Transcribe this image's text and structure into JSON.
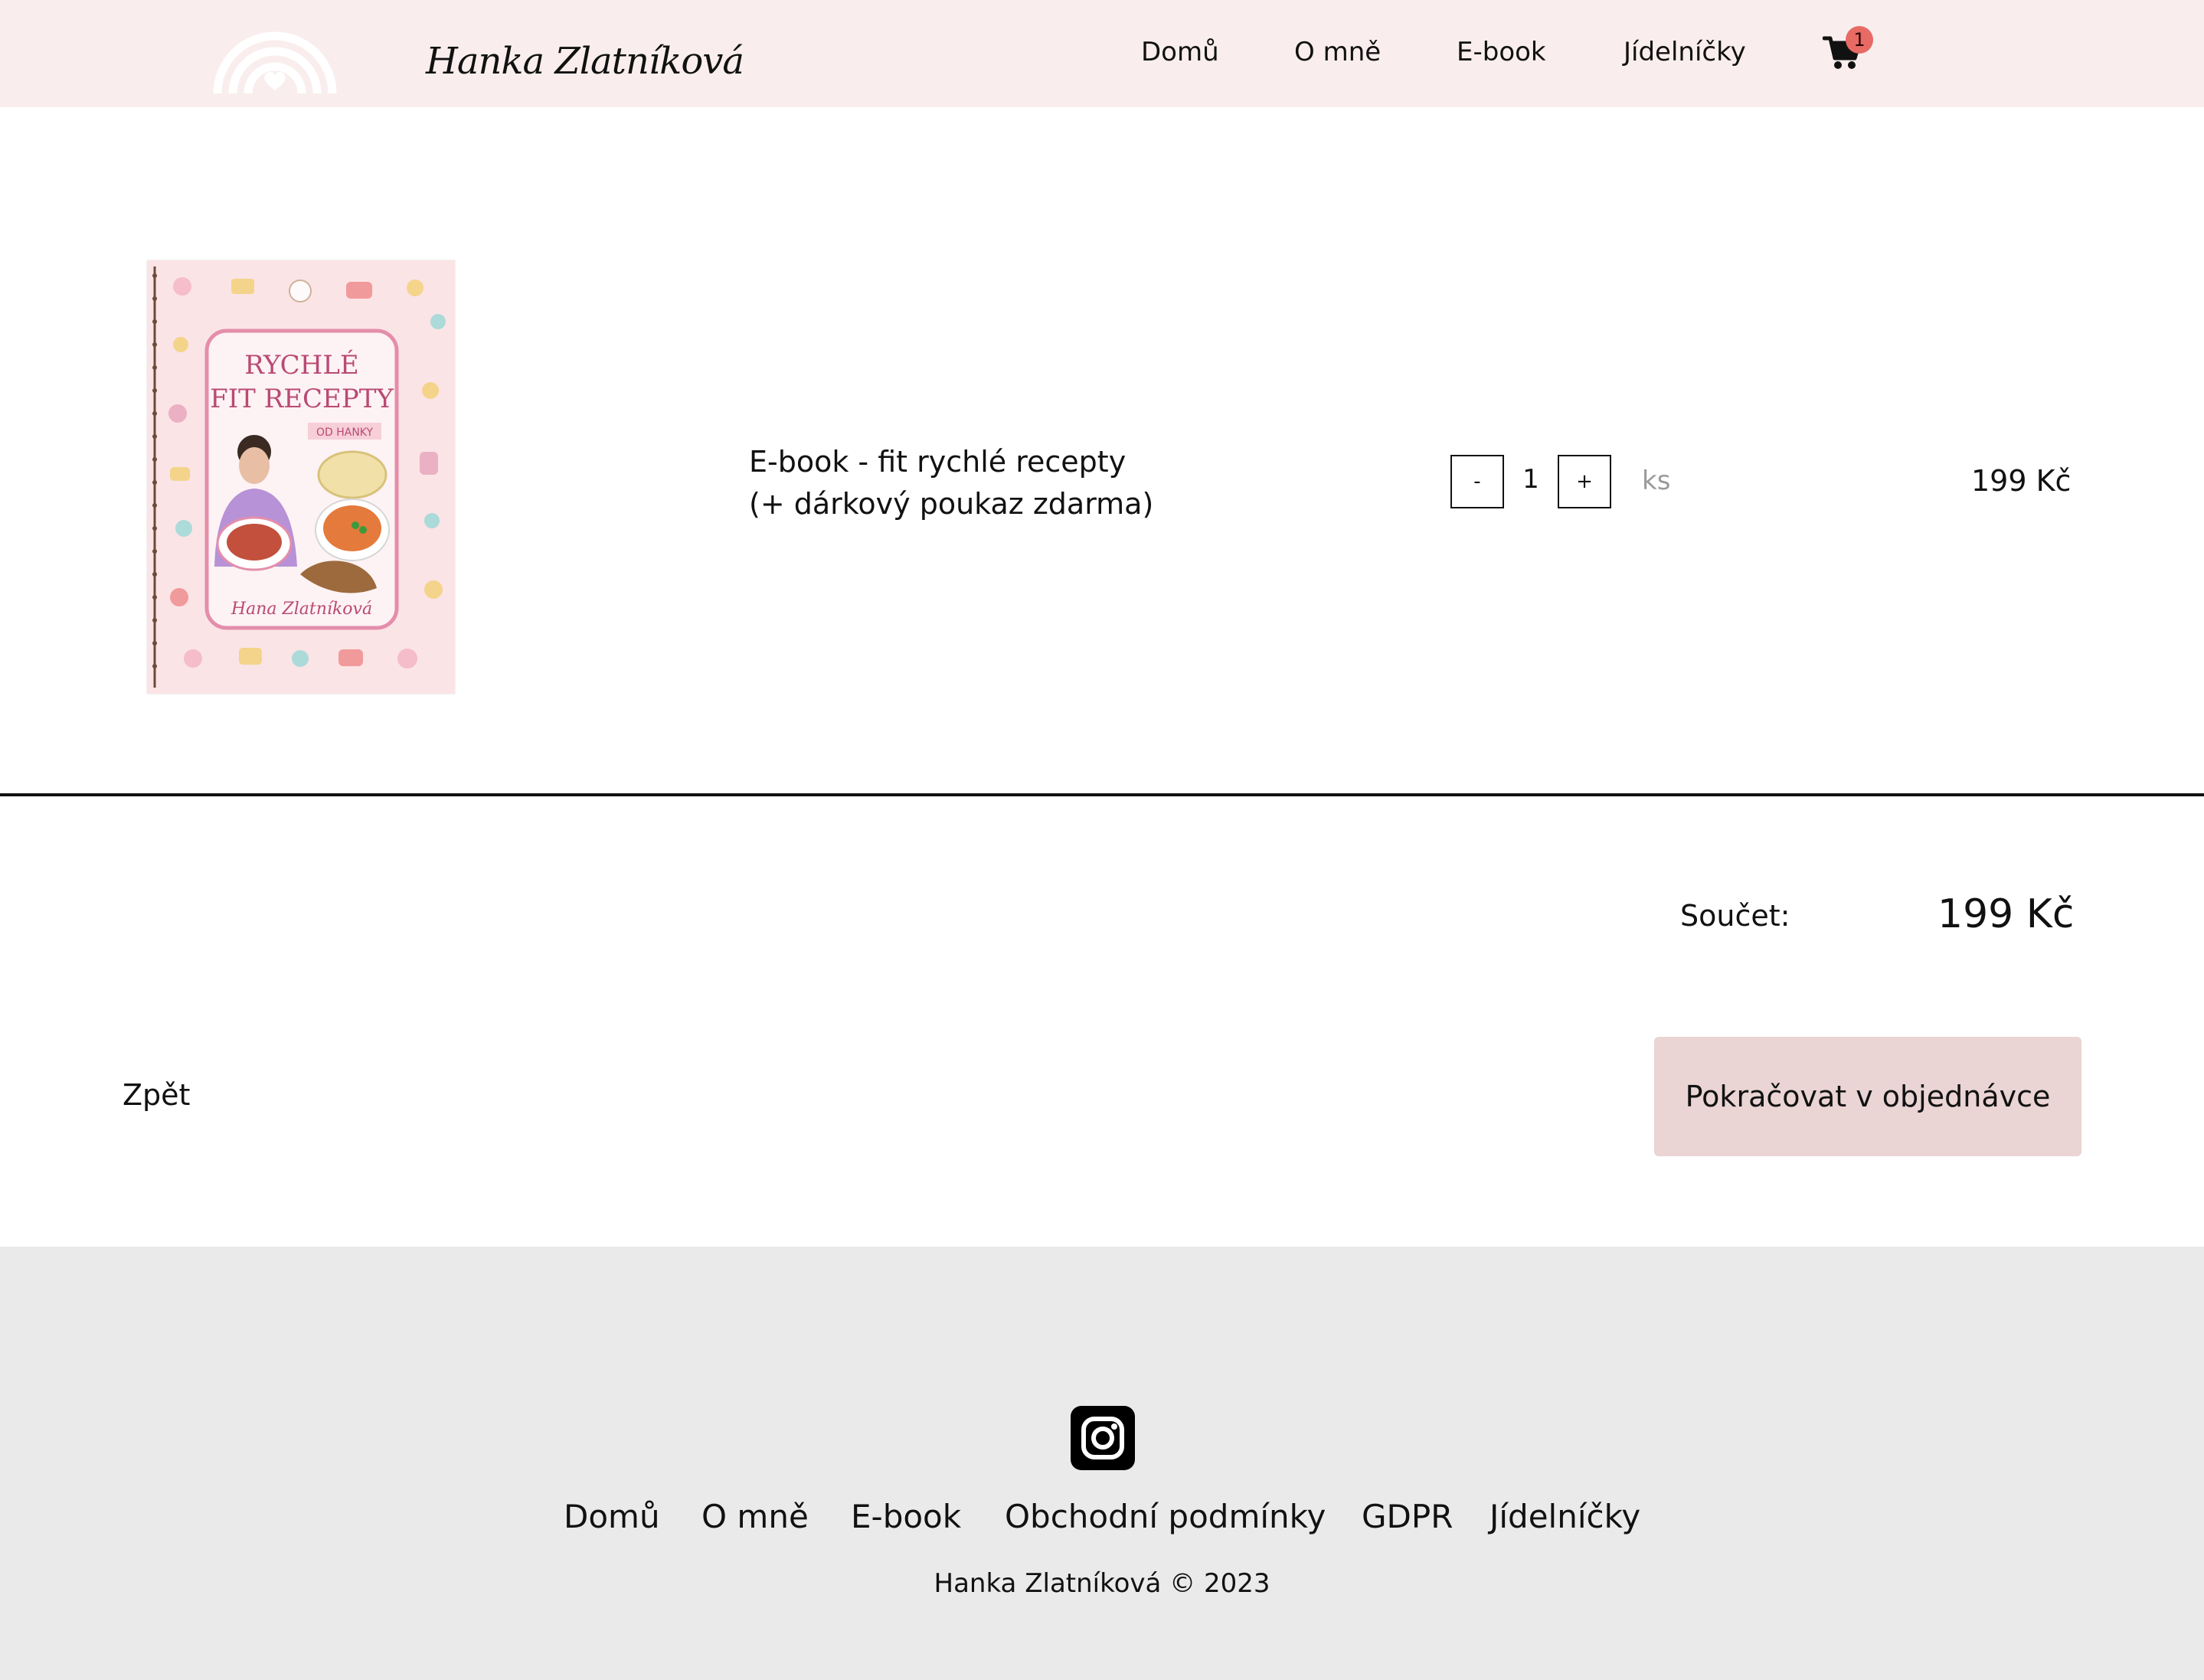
{
  "header": {
    "brand_name": "Hanka Zlatníková",
    "nav": {
      "home": "Domů",
      "about": "O mně",
      "ebook": "E-book",
      "menus": "Jídelníčky"
    },
    "cart_count": "1"
  },
  "cart": {
    "item": {
      "title_line1": "E-book - fit rychlé recepty",
      "title_line2": "(+ dárkový poukaz zdarma)",
      "cover": {
        "title_line1": "RYCHLÉ",
        "title_line2": "FIT RECEPTY",
        "subtitle": "OD HANKY",
        "author": "Hana Zlatníková"
      },
      "qty_minus": "-",
      "qty_plus": "+",
      "quantity": "1",
      "unit": "ks",
      "price": "199 Kč"
    },
    "total_label": "Součet:",
    "total_value": "199 Kč",
    "back_label": "Zpět",
    "continue_label": "Pokračovat v objednávce"
  },
  "footer": {
    "nav": {
      "home": "Domů",
      "about": "O mně",
      "ebook": "E-book",
      "terms": "Obchodní podmínky",
      "gdpr": "GDPR",
      "menus": "Jídelníčky"
    },
    "copyright": "Hanka Zlatníková © 2023"
  },
  "colors": {
    "header_bg": "#f9eeed",
    "badge": "#e86a64",
    "button_bg": "#ead4d4",
    "footer_bg": "#ebeaea",
    "cover_accent": "#b94a73"
  },
  "icons": {
    "logo": "rainbow-heart-logo",
    "cart": "shopping-cart-icon",
    "social": "instagram-icon"
  }
}
